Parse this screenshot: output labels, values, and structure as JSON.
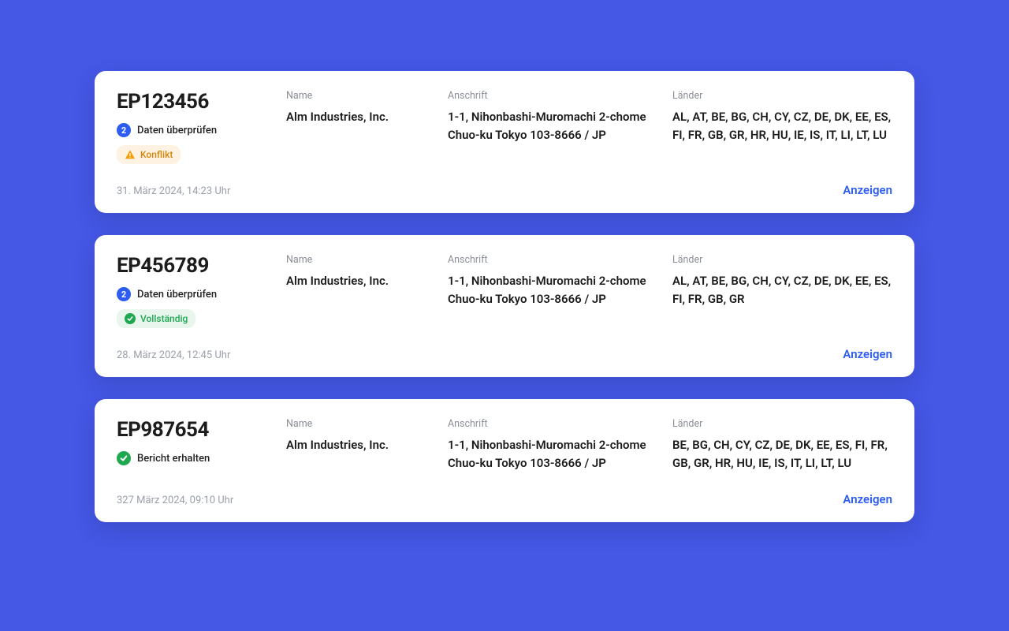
{
  "labels": {
    "name": "Name",
    "address": "Anschrift",
    "countries": "Länder",
    "view": "Anzeigen"
  },
  "cards": [
    {
      "id": "EP123456",
      "step_number": "2",
      "step_label": "Daten überprüfen",
      "badge_type": "warn",
      "badge_text": "Konflikt",
      "name": "Alm Industries, Inc.",
      "address_line1": "1-1, Nihonbashi-Muromachi 2-chome",
      "address_line2": "Chuo-ku Tokyo 103-8666 / JP",
      "countries": "AL, AT, BE, BG, CH, CY, CZ, DE, DK, EE, ES, FI, FR, GB, GR, HR, HU, IE, IS, IT, LI, LT, LU",
      "timestamp": "31. März 2024, 14:23 Uhr"
    },
    {
      "id": "EP456789",
      "step_number": "2",
      "step_label": "Daten überprüfen",
      "badge_type": "ok",
      "badge_text": "Vollständig",
      "name": "Alm Industries, Inc.",
      "address_line1": "1-1, Nihonbashi-Muromachi 2-chome",
      "address_line2": "Chuo-ku Tokyo 103-8666 / JP",
      "countries": "AL, AT, BE, BG, CH, CY, CZ, DE, DK, EE, ES, FI, FR, GB, GR",
      "timestamp": "28. März 2024, 12:45 Uhr"
    },
    {
      "id": "EP987654",
      "step_number": "check",
      "step_label": "Bericht erhalten",
      "badge_type": "none",
      "badge_text": "",
      "name": "Alm Industries, Inc.",
      "address_line1": "1-1, Nihonbashi-Muromachi 2-chome",
      "address_line2": "Chuo-ku Tokyo 103-8666 / JP",
      "countries": "BE, BG, CH, CY, CZ, DE, DK, EE, ES, FI, FR, GB, GR, HR, HU, IE, IS, IT, LI, LT, LU",
      "timestamp": "327 März 2024, 09:10 Uhr"
    }
  ]
}
